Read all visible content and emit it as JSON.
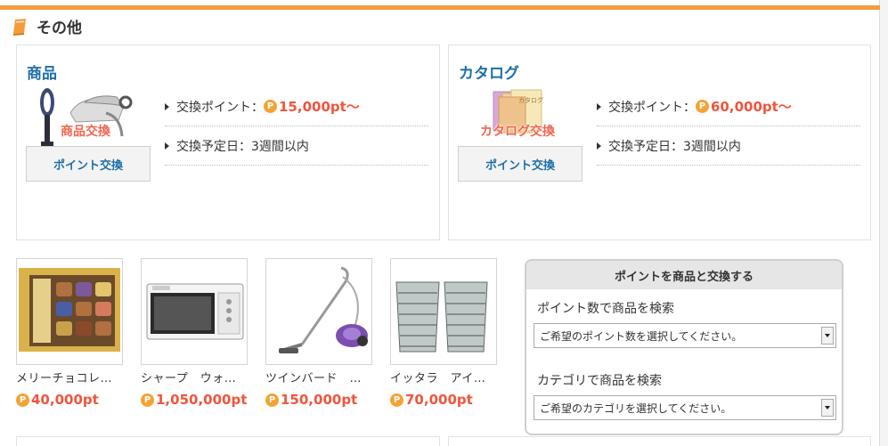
{
  "section": {
    "title": "その他"
  },
  "cards": [
    {
      "title": "商品",
      "thumb_label": "商品交換",
      "button": "ポイント交換",
      "exchange_points_label": "交換ポイント：",
      "exchange_points_value": "15,000pt〜",
      "schedule": "交換予定日：3週間以内"
    },
    {
      "title": "カタログ",
      "thumb_label": "カタログ交換",
      "button": "ポイント交換",
      "exchange_points_label": "交換ポイント：",
      "exchange_points_value": "60,000pt〜",
      "schedule": "交換予定日：3週間以内"
    }
  ],
  "point_icon": "P",
  "products": [
    {
      "name": "メリーチョコレ…",
      "price": "40,000pt"
    },
    {
      "name": "シャープ　ウォ…",
      "price": "1,050,000pt"
    },
    {
      "name": "ツインバード　…",
      "price": "150,000pt"
    },
    {
      "name": "イッタラ　アイ…",
      "price": "70,000pt"
    }
  ],
  "search": {
    "title": "ポイントを商品と交換する",
    "by_points_label": "ポイント数で商品を検索",
    "by_points_select": "ご希望のポイント数を選択してください。",
    "by_category_label": "カテゴリで商品を検索",
    "by_category_select": "ご希望のカテゴリを選択してください。"
  },
  "colors": {
    "accent": "#f59b3a",
    "link": "#1d6fa8",
    "price": "#f0553d"
  }
}
